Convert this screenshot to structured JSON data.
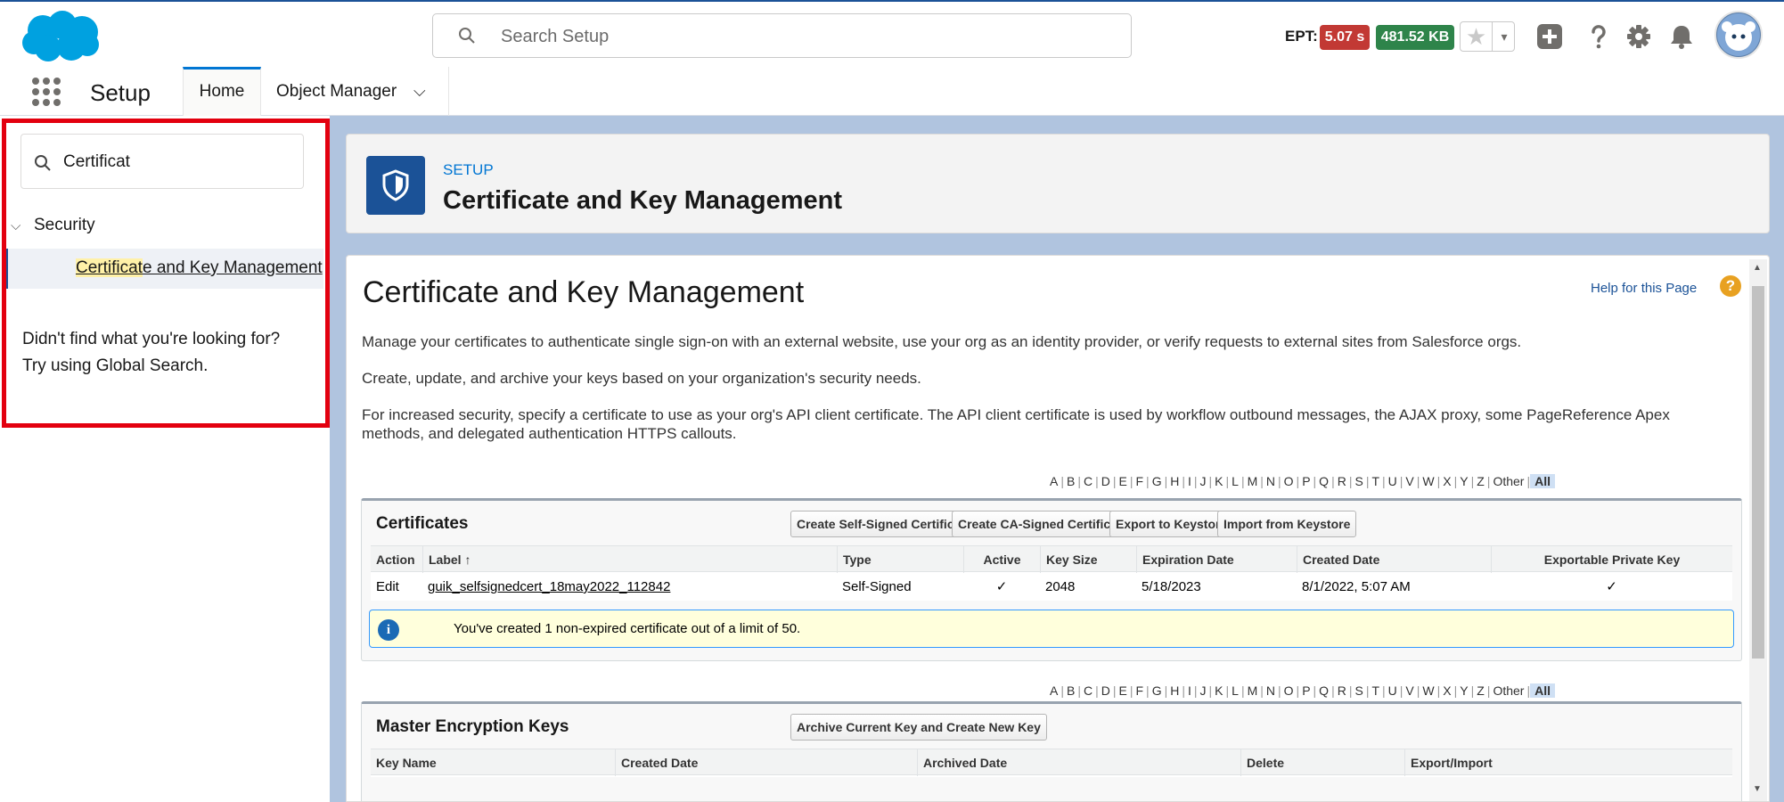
{
  "header": {
    "search_placeholder": "Search Setup",
    "ept_label": "EPT:",
    "ept_time": "5.07 s",
    "ept_size": "481.52 KB",
    "favorite_star": "★",
    "favorite_caret": "▾"
  },
  "context_bar": {
    "app_name": "Setup",
    "tabs": [
      {
        "label": "Home"
      },
      {
        "label": "Object Manager"
      }
    ],
    "chevron": "⌵"
  },
  "sidebar": {
    "quick_find_value": "Certificat",
    "section": "Security",
    "chevron": "⌵",
    "item_highlight": "Certificat",
    "item_rest": "e and Key Management",
    "not_found_line1": "Didn't find what you're looking for?",
    "not_found_line2": "Try using Global Search."
  },
  "page_header": {
    "eyebrow": "SETUP",
    "title": "Certificate and Key Management"
  },
  "content": {
    "title": "Certificate and Key Management",
    "help_link": "Help for this Page",
    "help_icon": "?",
    "para1": "Manage your certificates to authenticate single sign-on with an external website, use your org as an identity provider, or verify requests to external sites from Salesforce orgs.",
    "para2": "Create, update, and archive your keys based on your organization's security needs.",
    "para3": "For increased security, specify a certificate to use as your org's API client certificate. The API client certificate is used by workflow outbound messages, the AJAX proxy, some PageReference Apex methods, and delegated authentication HTTPS callouts.",
    "alpha": [
      "A",
      "B",
      "C",
      "D",
      "E",
      "F",
      "G",
      "H",
      "I",
      "J",
      "K",
      "L",
      "M",
      "N",
      "O",
      "P",
      "Q",
      "R",
      "S",
      "T",
      "U",
      "V",
      "W",
      "X",
      "Y",
      "Z",
      "Other",
      "All"
    ]
  },
  "certificates": {
    "title": "Certificates",
    "buttons": [
      "Create Self-Signed Certificate",
      "Create CA-Signed Certificate",
      "Export to Keystore",
      "Import from Keystore"
    ],
    "columns": [
      "Action",
      "Label ↑",
      "Type",
      "Active",
      "Key Size",
      "Expiration Date",
      "Created Date",
      "Exportable Private Key"
    ],
    "row": {
      "action": "Edit",
      "label": "guik_selfsignedcert_18may2022_112842",
      "type": "Self-Signed",
      "active": "✓",
      "key_size": "2048",
      "expiration": "5/18/2023",
      "created": "8/1/2022, 5:07 AM",
      "exportable": "✓"
    },
    "info_icon": "i",
    "info_message": "You've created 1 non-expired certificate out of a limit of 50."
  },
  "master_keys": {
    "title": "Master Encryption Keys",
    "button": "Archive Current Key and Create New Key",
    "columns": [
      "Key Name",
      "Created Date",
      "Archived Date",
      "Delete",
      "Export/Import"
    ]
  },
  "scrollbar": {
    "up": "▲",
    "down": "▼"
  }
}
